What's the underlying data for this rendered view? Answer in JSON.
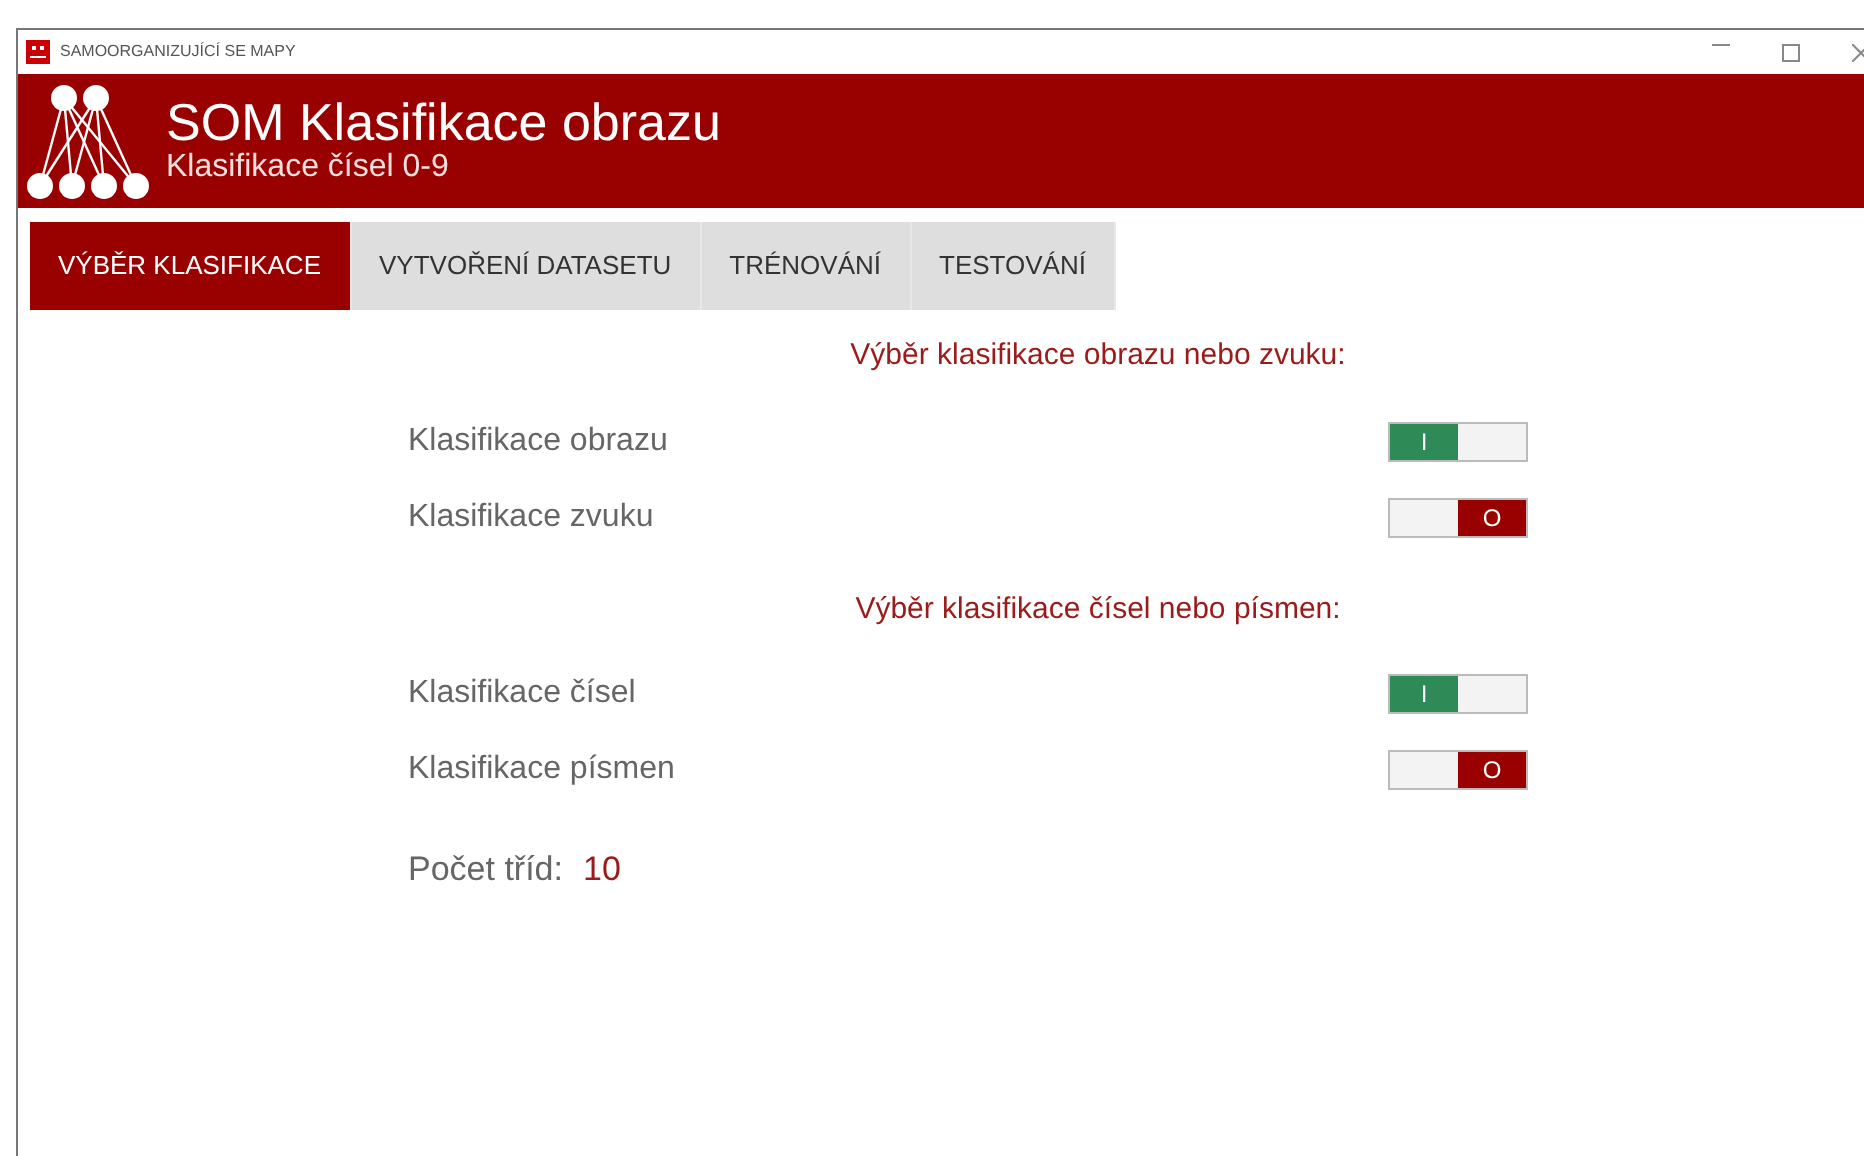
{
  "window": {
    "title": "SAMOORGANIZUJÍCÍ SE MAPY"
  },
  "header": {
    "title_bold": "SOM",
    "title_rest": "Klasifikace obrazu",
    "subtitle": "Klasifikace čísel 0-9"
  },
  "tabs": [
    {
      "label": "VÝBĚR KLASIFIKACE",
      "selected": true
    },
    {
      "label": "VYTVOŘENÍ DATASETU",
      "selected": false
    },
    {
      "label": "TRÉNOVÁNÍ",
      "selected": false
    },
    {
      "label": "TESTOVÁNÍ",
      "selected": false
    }
  ],
  "sections": [
    {
      "heading": "Výběr klasifikace obrazu nebo zvuku:",
      "options": [
        {
          "label": "Klasifikace obrazu",
          "on": true,
          "switch_text": "I"
        },
        {
          "label": "Klasifikace zvuku",
          "on": false,
          "switch_text": "O"
        }
      ]
    },
    {
      "heading": "Výběr klasifikace čísel nebo písmen:",
      "options": [
        {
          "label": "Klasifikace čísel",
          "on": true,
          "switch_text": "I"
        },
        {
          "label": "Klasifikace písmen",
          "on": false,
          "switch_text": "O"
        }
      ]
    }
  ],
  "class_count": {
    "label": "Počet tříd:",
    "value": "10"
  }
}
